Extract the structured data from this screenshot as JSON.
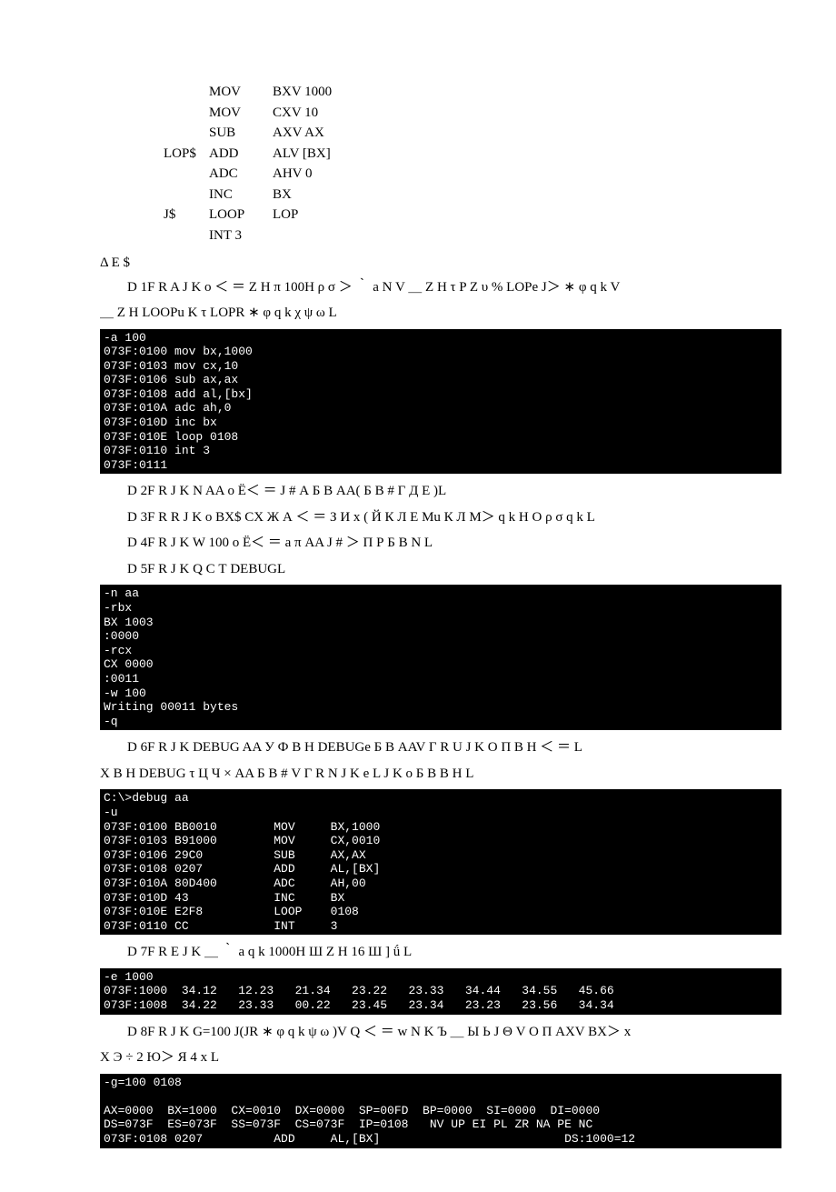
{
  "asm": [
    {
      "label": "",
      "op": "MOV",
      "arg": "BXV 1000"
    },
    {
      "label": "",
      "op": "MOV",
      "arg": "CXV 10"
    },
    {
      "label": "",
      "op": "SUB",
      "arg": "AXV AX"
    },
    {
      "label": "LOP$",
      "op": "ADD",
      "arg": "ALV [BX]"
    },
    {
      "label": "",
      "op": "ADC",
      "arg": "AHV 0"
    },
    {
      "label": "",
      "op": "INC",
      "arg": "BX"
    },
    {
      "label": "J$",
      "op": "LOOP",
      "arg": "LOP"
    },
    {
      "label": "",
      "op": "INT 3",
      "arg": ""
    }
  ],
  "sectionHead": "Δ Ε $",
  "p1a": "D 1F R  A J K   о ＜ ＝ Z H π 100H ρ σ ＞ ｀ а N V ＿ Z H τ P Z   υ %  LOPе J＞ ∗  φ q  k  V",
  "p1b": "＿  Z H LOOPu  K  τ LOPR ∗  φ q  k   χ ψ ω L",
  "term1": "-a 100\n073F:0100 mov bx,1000\n073F:0103 mov cx,10\n073F:0106 sub ax,ax\n073F:0108 add al,[bx]\n073F:010A adc ah,0\n073F:010D inc bx\n073F:010E loop 0108\n073F:0110 int 3\n073F:0111",
  "p2": "D 2F R J K N    AA  о Ё＜ ＝ J #  А Б В AA( Б В #  Г Д Е )L",
  "p3": "D 3F R  R J K  о BX$  CX Ж А ＜ ＝  З И х ( Й К Л Е  Мu  К  Л М＞ q  k   Н О ρ σ q  k  L",
  "p4": "D 4F R J K  W 100 о  Ё＜ ＝ а  π AA J # ＞  П Р Б B N L",
  "p5": "D 5F R J K  Q С Т DEBUGL",
  "term2": "-n aa\n-rbx\nBX 1003\n:0000\n-rcx\nCX 0000\n:0011\n-w 100\nWriting 00011 bytes\n-q",
  "p6a": "D 6F R J K DEBUG    AA У Ф В  Н DEBUGе  Б В AAV  Г R  U J K  О П В  H ＜ ＝ L",
  "p6b": " Х В  Н DEBUG τ  Ц Ч × AA Б В #  V  Г R  N J K  е  L J K  о  Б В В  H L",
  "term3": "C:\\>debug aa\n-u\n073F:0100 BB0010        MOV     BX,1000\n073F:0103 B91000        MOV     CX,0010\n073F:0106 29C0          SUB     AX,AX\n073F:0108 0207          ADD     AL,[BX]\n073F:010A 80D400        ADC     AH,00\n073F:010D 43            INC     BX\n073F:010E E2F8          LOOP    0108\n073F:0110 CC            INT     3",
  "p7": "D 7F R  E J K ＿ ｀ а q  k  1000H Ш Z H 16 Ш ]  ǘ  L",
  "term4": "-e 1000\n073F:1000  34.12   12.23   21.34   23.22   23.33   34.44   34.55   45.66\n073F:1008  34.22   23.33   00.22   23.45   23.34   23.23   23.56   34.34",
  "p8a": "D 8F R J K  G=100 J(JR ∗  φ q  k   ψ ω )V Q  ＜ ＝ w  N K Ъ ＿  Ы Ь J Θ V  О П AXV BX＞  х",
  "p8b": "Х Э ÷ 2  Ю＞  Я 4  х L",
  "term5": "-g=100 0108\n\nAX=0000  BX=1000  CX=0010  DX=0000  SP=00FD  BP=0000  SI=0000  DI=0000\nDS=073F  ES=073F  SS=073F  CS=073F  IP=0108   NV UP EI PL ZR NA PE NC\n073F:0108 0207          ADD     AL,[BX]                          DS:1000=12"
}
